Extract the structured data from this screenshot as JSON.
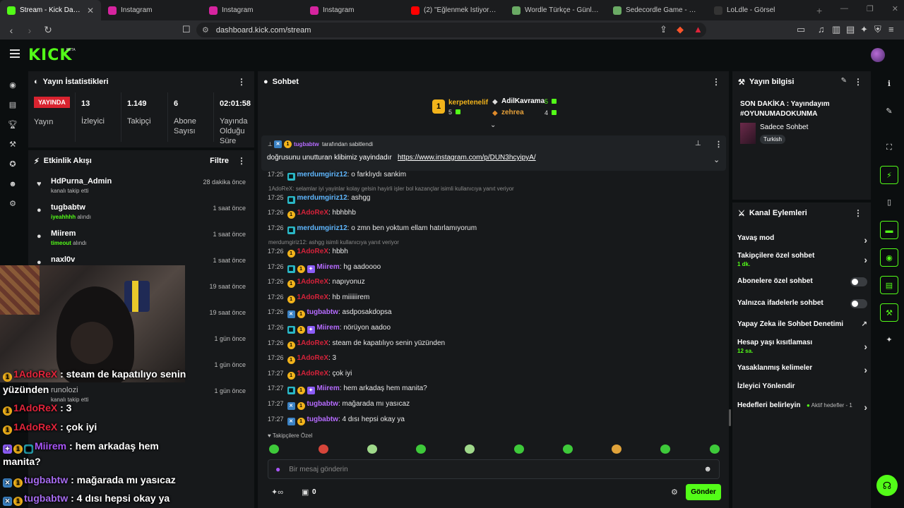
{
  "browser": {
    "tabs": [
      {
        "label": "Stream - Kick Dashboard",
        "color": "#53fc18"
      },
      {
        "label": "Instagram",
        "color": "#d6249f"
      },
      {
        "label": "Instagram",
        "color": "#d6249f"
      },
      {
        "label": "Instagram",
        "color": "#d6249f"
      },
      {
        "label": "(2) \"Eğlenmek İstiyorsan İzle\" #...",
        "color": "#ff0000"
      },
      {
        "label": "Wordle Türkçe - Günlük Kelime...",
        "color": "#6aaa64"
      },
      {
        "label": "Sedecordle Game - 16 Words...",
        "color": "#6aaa64"
      },
      {
        "label": "LoLdle - Görsel",
        "color": "#1a1a1a"
      }
    ],
    "url": "dashboard.kick.com/stream"
  },
  "header": {
    "logo": "KICK",
    "beta": "BETA"
  },
  "stats": {
    "title": "Yayın İstatistikleri",
    "live": "YAYINDA",
    "live_label": "Yayın",
    "viewers": "13",
    "viewers_label": "İzleyici",
    "followers": "1.149",
    "followers_label": "Takipçi",
    "subs": "6",
    "subs_label": "Abone Sayısı",
    "duration": "02:01:58",
    "duration_label": "Yayında Olduğu Süre"
  },
  "activity": {
    "title": "Etkinlik Akışı",
    "filter": "Filtre",
    "items": [
      {
        "name": "HdPurna_Admin",
        "sub": "kanalı takip etti",
        "time": "28 dakika önce"
      },
      {
        "name": "tugbabtw",
        "sub_bold": "iyeahhhh",
        "sub": "alındı",
        "time": "1 saat önce"
      },
      {
        "name": "Miirem",
        "sub_bold": "timeout",
        "sub": "alındı",
        "time": "1 saat önce"
      },
      {
        "name": "naxl0v",
        "sub": "",
        "time": "1 saat önce"
      },
      {
        "name": "",
        "sub": "",
        "time": "19 saat önce"
      },
      {
        "name": "",
        "sub": "",
        "time": "19 saat önce"
      },
      {
        "name": "",
        "sub": "",
        "time": "1 gün önce"
      },
      {
        "name": "",
        "sub": "",
        "time": "1 gün önce"
      },
      {
        "name": "runolozi",
        "sub": "kanalı takip etti",
        "time": "1 gün önce"
      }
    ]
  },
  "overlay": [
    {
      "user": "1AdoReX",
      "text": ": steam de kapatılıyo senin",
      "cont": "yüzünden"
    },
    {
      "user": "1AdoReX",
      "text": ": 3"
    },
    {
      "user": "1AdoReX",
      "text": ": çok iyi"
    },
    {
      "user": "Miirem",
      "text": ": hem arkadaş hem",
      "cont": "manita?"
    },
    {
      "user": "tugbabtw",
      "text": ": mağarada mı yasıcaz"
    },
    {
      "user": "tugbabtw",
      "text": ": 4 dısı hepsi okay ya"
    }
  ],
  "chat": {
    "title": "Sohbet",
    "top": [
      {
        "rank": "1",
        "name": "kerpetenelif",
        "count": "5"
      },
      {
        "name": "AdilKavrama",
        "count": "5"
      },
      {
        "name": "zehrea",
        "count": "4"
      }
    ],
    "pinned_by": "tugbabtw",
    "pinned_suffix": "tarafından sabitlendi",
    "pinned_text": "doğrusunu unutturan klibimiz yayindadır",
    "pinned_link": "https://www.instagram.com/p/DUN3hcyipyA/",
    "messages": [
      {
        "ts": "17:25",
        "nick": "merdumgiriz12",
        "cls": "n-blue",
        "text": ": o farklıydı sankim"
      },
      {
        "reply": "1AdoReX: selamlar iyi yayinlar kolay gelsin hayirli işler bol kazançlar isimli kullanıcıya yanıt veriyor"
      },
      {
        "ts": "17:25",
        "nick": "merdumgiriz12",
        "cls": "n-blue",
        "text": ": ashgg"
      },
      {
        "ts": "17:26",
        "nick": "1AdoReX",
        "cls": "n-red",
        "text": ": hbhbhb"
      },
      {
        "ts": "17:26",
        "nick": "merdumgiriz12",
        "cls": "n-blue",
        "text": ": o zmn ben yoktum ellam hatırlamıyorum"
      },
      {
        "reply": "merdumgiriz12: ashgg isimli kullanıcıya yanıt veriyor"
      },
      {
        "ts": "17:26",
        "nick": "1AdoReX",
        "cls": "n-red",
        "text": ": hbbh"
      },
      {
        "ts": "17:26",
        "nick": "Miirem",
        "cls": "n-purple",
        "text": ": hg aadoooo"
      },
      {
        "ts": "17:26",
        "nick": "1AdoReX",
        "cls": "n-red",
        "text": ": napıyonuz"
      },
      {
        "ts": "17:26",
        "nick": "1AdoReX",
        "cls": "n-red",
        "text": ": hb miiiiiirem"
      },
      {
        "ts": "17:26",
        "nick": "tugbabtw",
        "cls": "n-purple",
        "text": ": asdposakdopsa"
      },
      {
        "ts": "17:26",
        "nick": "Miirem",
        "cls": "n-purple",
        "text": ": nörüyon aadoo"
      },
      {
        "ts": "17:26",
        "nick": "1AdoReX",
        "cls": "n-red",
        "text": ": steam de kapatılıyo senin yüzünden"
      },
      {
        "ts": "17:26",
        "nick": "1AdoReX",
        "cls": "n-red",
        "text": ": 3"
      },
      {
        "ts": "17:27",
        "nick": "1AdoReX",
        "cls": "n-red",
        "text": ": çok iyi"
      },
      {
        "ts": "17:27",
        "nick": "Miirem",
        "cls": "n-purple",
        "text": ": hem arkadaş hem manita?"
      },
      {
        "ts": "17:27",
        "nick": "tugbabtw",
        "cls": "n-purple",
        "text": ": mağarada mı yasıcaz"
      },
      {
        "ts": "17:27",
        "nick": "tugbabtw",
        "cls": "n-purple",
        "text": ": 4 dısı hepsi okay ya"
      }
    ],
    "followers_only": "Takipçilere Özel",
    "placeholder": "Bir mesaj gönderin",
    "points": "0",
    "send": "Gönder"
  },
  "stream_info": {
    "title": "Yayın bilgisi",
    "stream_title": "SON DAKİKA : Yayındayım #OYUNUMADOKUNMA",
    "category": "Sadece Sohbet",
    "tag": "Turkish"
  },
  "channel_actions": {
    "title": "Kanal Eylemleri",
    "slow": "Yavaş mod",
    "followers": "Takipçilere özel sohbet",
    "followers_sub": "1 dk.",
    "subs": "Abonelere özel sohbet",
    "emotes": "Yalnızca ifadelerle sohbet",
    "ai": "Yapay Zeka ile Sohbet Denetimi",
    "age": "Hesap yaşı kısıtlaması",
    "age_sub": "12 sa.",
    "banned": "Yasaklanmış kelimeler",
    "redirect": "İzleyici Yönlendir",
    "goals": "Hedefleri belirleyin",
    "goals_active": "Aktif hedefler - 1"
  }
}
